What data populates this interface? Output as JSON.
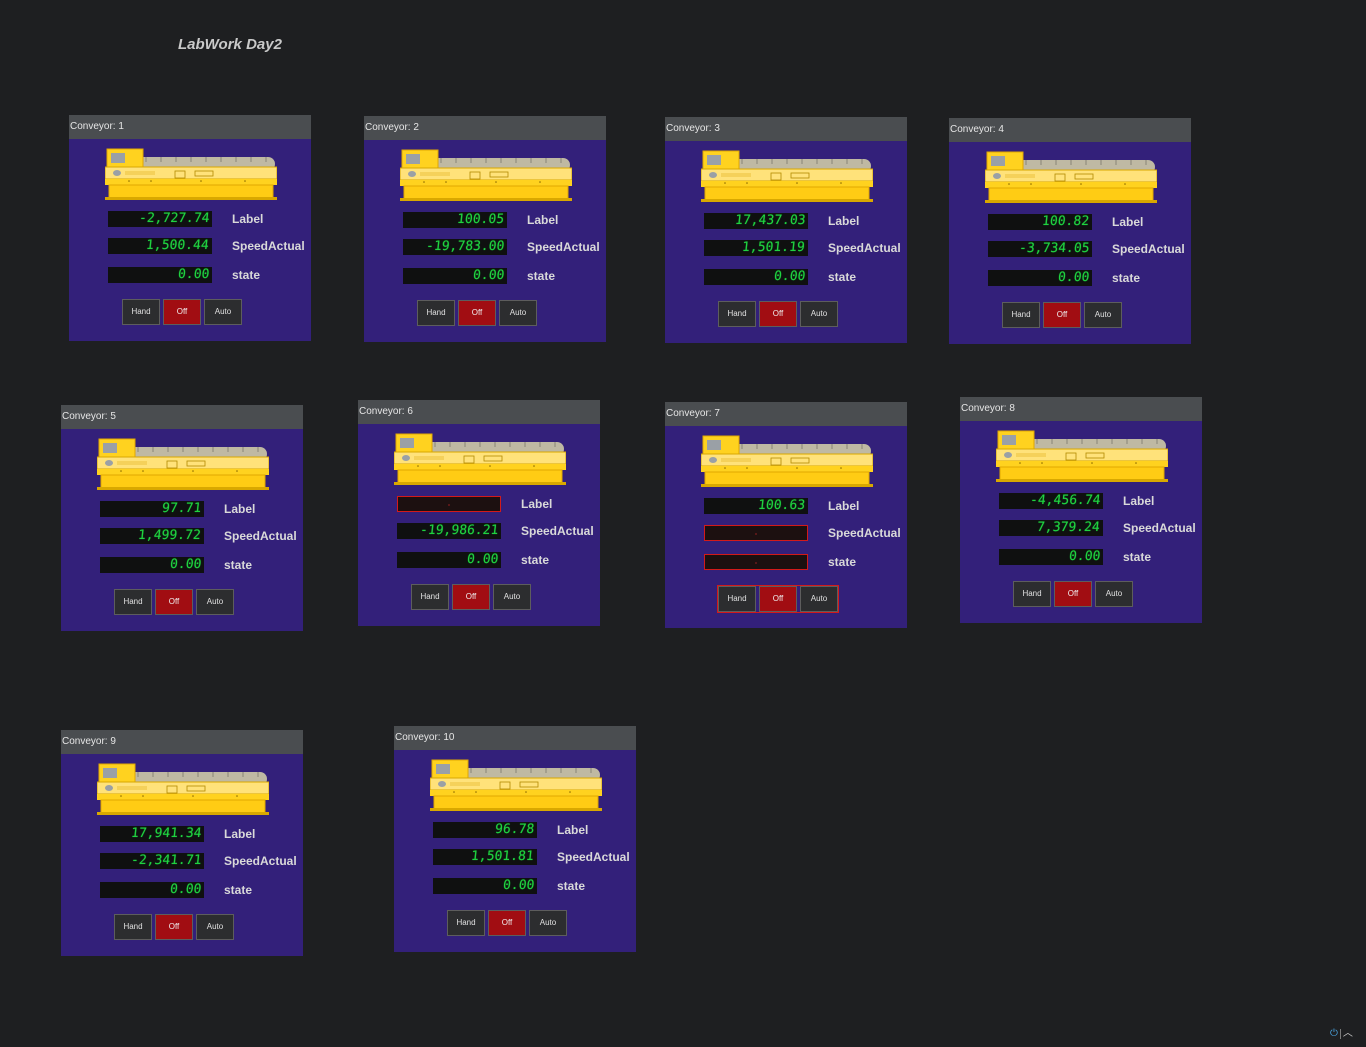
{
  "app": {
    "title": "LabWork Day2"
  },
  "labels": {
    "label": "Label",
    "speed": "SpeedActual",
    "state": "state"
  },
  "buttons": {
    "hand": "Hand",
    "off": "Off",
    "auto": "Auto"
  },
  "colors": {
    "background": "#1e1f21",
    "panel": "#33207a",
    "header": "#4a4d50",
    "digits": "#20d240",
    "off_active": "#a10d12",
    "alarm_border": "#d31a1a",
    "conveyor_yellow": "#ffd21f"
  },
  "panels": [
    {
      "header": "Conveyor: 1",
      "label_value": "-2,727.74",
      "speed_value": "1,500.44",
      "state_value": "0.00",
      "label_bad": false,
      "speed_bad": false,
      "state_bad": false,
      "alarm": false
    },
    {
      "header": "Conveyor: 2",
      "label_value": "100.05",
      "speed_value": "-19,783.00",
      "state_value": "0.00",
      "label_bad": false,
      "speed_bad": false,
      "state_bad": false,
      "alarm": false
    },
    {
      "header": "Conveyor: 3",
      "label_value": "17,437.03",
      "speed_value": "1,501.19",
      "state_value": "0.00",
      "label_bad": false,
      "speed_bad": false,
      "state_bad": false,
      "alarm": false
    },
    {
      "header": "Conveyor: 4",
      "label_value": "100.82",
      "speed_value": "-3,734.05",
      "state_value": "0.00",
      "label_bad": false,
      "speed_bad": false,
      "state_bad": false,
      "alarm": false
    },
    {
      "header": "Conveyor: 5",
      "label_value": "97.71",
      "speed_value": "1,499.72",
      "state_value": "0.00",
      "label_bad": false,
      "speed_bad": false,
      "state_bad": false,
      "alarm": false
    },
    {
      "header": "Conveyor: 6",
      "label_value": "",
      "speed_value": "-19,986.21",
      "state_value": "0.00",
      "label_bad": true,
      "speed_bad": false,
      "state_bad": false,
      "alarm": false
    },
    {
      "header": "Conveyor: 7",
      "label_value": "100.63",
      "speed_value": "",
      "state_value": "",
      "label_bad": false,
      "speed_bad": true,
      "state_bad": true,
      "alarm": true
    },
    {
      "header": "Conveyor: 8",
      "label_value": "-4,456.74",
      "speed_value": "7,379.24",
      "state_value": "0.00",
      "label_bad": false,
      "speed_bad": false,
      "state_bad": false,
      "alarm": false
    },
    {
      "header": "Conveyor: 9",
      "label_value": "17,941.34",
      "speed_value": "-2,341.71",
      "state_value": "0.00",
      "label_bad": false,
      "speed_bad": false,
      "state_bad": false,
      "alarm": false
    },
    {
      "header": "Conveyor: 10",
      "label_value": "96.78",
      "speed_value": "1,501.81",
      "state_value": "0.00",
      "label_bad": false,
      "speed_bad": false,
      "state_bad": false,
      "alarm": false
    }
  ],
  "footer": {
    "power_icon": "power-icon",
    "caret_icon": "caret-up-icon"
  }
}
